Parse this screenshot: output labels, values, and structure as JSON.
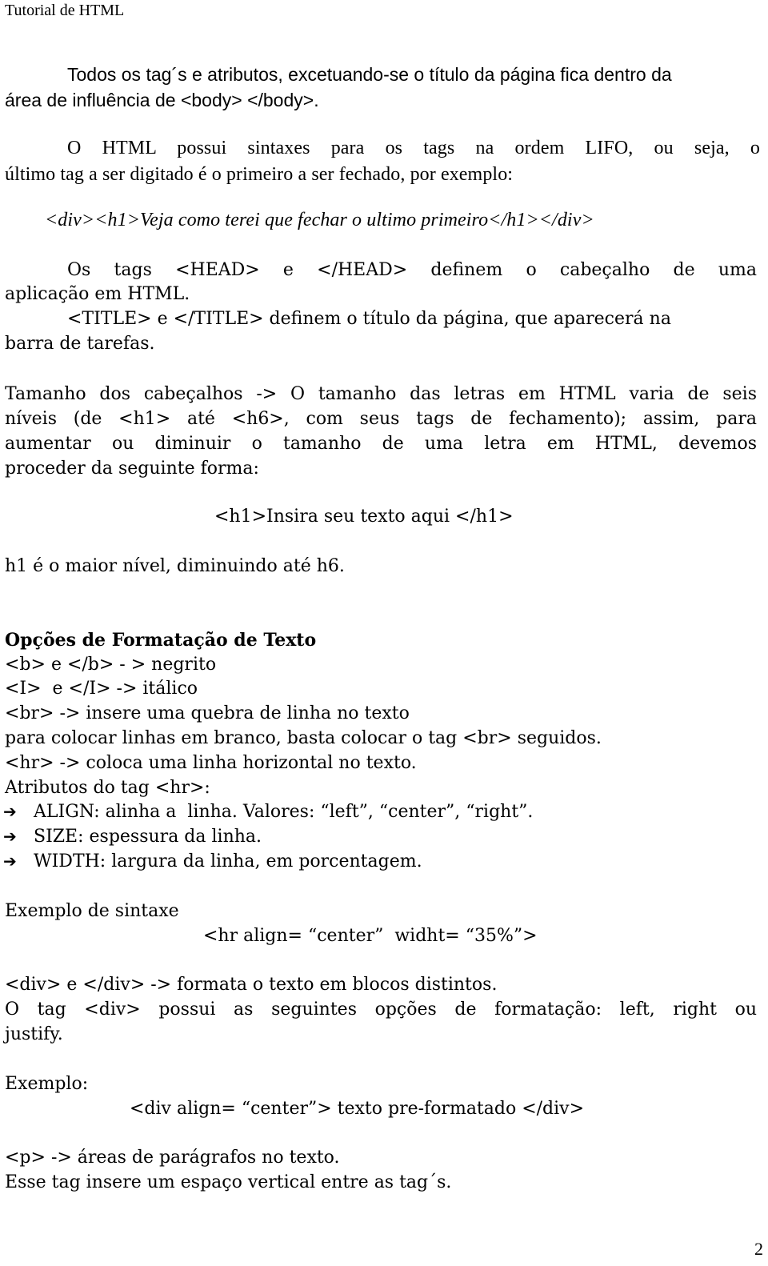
{
  "header": {
    "title": "Tutorial de HTML"
  },
  "intro": {
    "line1": "Todos os tag´s e atributos, excetuando-se o título da página fica dentro da",
    "line2": "área de influência de <body> </body>."
  },
  "lifo": {
    "line1": "O HTML possui sintaxes para os tags na ordem LIFO, ou seja, o",
    "line2": "último tag a ser digitado é o primeiro a ser fechado, por exemplo:",
    "example": "<div><h1>Veja como terei que fechar o ultimo primeiro</h1></div>"
  },
  "head": {
    "line1": "Os tags <HEAD> e </HEAD> definem o cabeçalho de uma",
    "line2": "aplicação em HTML.",
    "title_line1": "<TITLE> e </TITLE> definem o título da página, que aparecerá na",
    "title_line2": "barra de tarefas."
  },
  "headings": {
    "line1": "Tamanho dos cabeçalhos -> O tamanho das letras em HTML varia de seis",
    "line2": "níveis (de <h1> até <h6>, com seus tags de fechamento); assim, para",
    "line3": "aumentar ou diminuir o tamanho de uma letra em HTML, devemos",
    "line4": "proceder da seguinte forma:",
    "example": "<h1>Insira seu texto aqui </h1>",
    "note": "h1 é o maior nível, diminuindo até h6."
  },
  "formatting": {
    "title": "Opções de Formatação de Texto",
    "items": [
      "<b> e </b> - > negrito",
      "<I>  e </I> -> itálico",
      "<br> -> insere uma quebra de linha no texto",
      "para colocar linhas em branco, basta colocar o tag <br> seguidos.",
      "<hr> -> coloca uma linha horizontal no texto.",
      "Atributos do tag <hr>:"
    ],
    "attributes": [
      {
        "icon": "➔",
        "text": "ALIGN: alinha a  linha. Valores: “left”, “center”, “right”."
      },
      {
        "icon": "➔",
        "text": "SIZE: espessura da linha."
      },
      {
        "icon": "➔",
        "text": "WIDTH: largura da linha, em porcentagem."
      }
    ],
    "syntax_label": "Exemplo de sintaxe",
    "syntax_example": "<hr align= “center”  widht= “35%”>"
  },
  "div": {
    "line1": "<div> e </div> -> formata o texto em blocos distintos.",
    "line2": "O tag <div> possui as seguintes opções de formatação: left, right ou",
    "line3": "justify.",
    "example_label": "Exemplo:",
    "example": "<div align= “center”> texto pre-formatado </div>"
  },
  "paragraph": {
    "line1": "<p> -> áreas de parágrafos no texto.",
    "line2": "Esse tag insere um espaço vertical entre as tag´s."
  },
  "footer": {
    "page_number": "2"
  }
}
